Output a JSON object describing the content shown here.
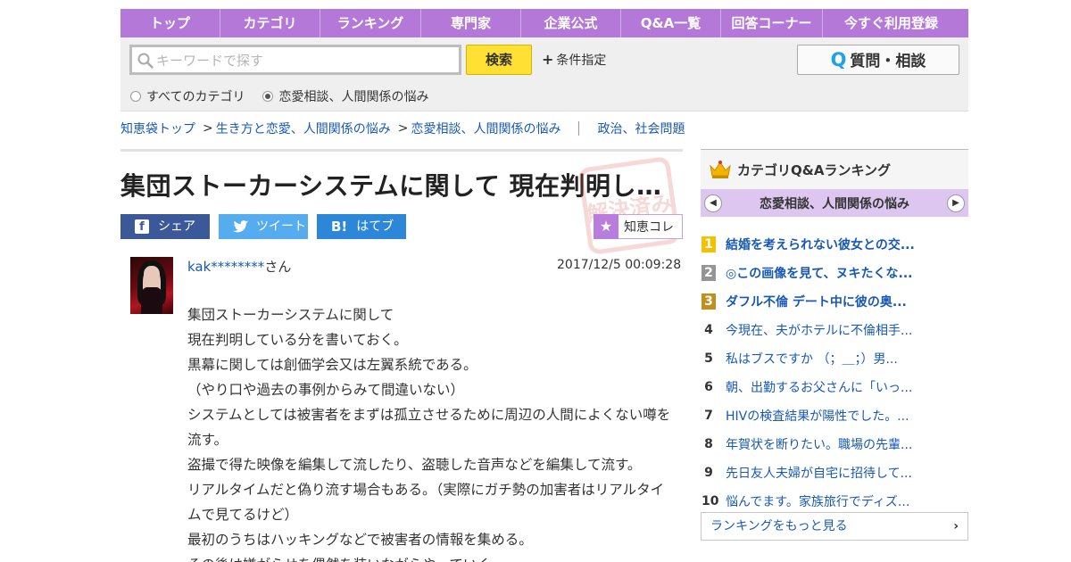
{
  "nav": {
    "items": [
      "トップ",
      "カテゴリ",
      "ランキング",
      "専門家",
      "企業公式",
      "Q&A一覧",
      "回答コーナー",
      "今すぐ利用登録"
    ]
  },
  "search": {
    "placeholder": "キーワードで探す",
    "button_label": "検索",
    "condition_label": "条件指定",
    "ask_label": "質問・相談",
    "ask_prefix": "Q",
    "radio_all": "すべてのカテゴリ",
    "radio_current": "恋愛相談、人間関係の悩み",
    "selected": "恋愛相談、人間関係の悩み"
  },
  "breadcrumb": {
    "items": [
      "知恵袋トップ",
      "生き方と恋愛、人間関係の悩み",
      "恋愛相談、人間関係の悩み"
    ],
    "sep": ">",
    "related": "政治、社会問題"
  },
  "question": {
    "title": "集団ストーカーシステムに関して 現在判明し…",
    "share_fb": "シェア",
    "share_tw": "ツイート",
    "share_hb": "はてブ",
    "share_hb_icon": "B!",
    "chiecolle": "知恵コレ",
    "stamp_text": "解決済み",
    "user": "kak********",
    "user_suffix": "さん",
    "date": "2017/12/5  00:09:28",
    "body": [
      "集団ストーカーシステムに関して",
      "現在判明している分を書いておく。",
      "黒幕に関しては創価学会又は左翼系統である。",
      "（やり口や過去の事例からみて間違いない）",
      "システムとしては被害者をまずは孤立させるために周辺の人間によくない噂を流す。",
      "盗撮で得た映像を編集して流したり、盗聴した音声などを編集して流す。",
      "リアルタイムだと偽り流す場合もある。（実際にガチ勢の加害者はリアルタイムで見てるけど）",
      "最初のうちはハッキングなどで被害者の情報を集める。",
      "その後は嫌がらせを偶然を装いながらやっていく。"
    ]
  },
  "ranking": {
    "header": "カテゴリQ&Aランキング",
    "category": "恋愛相談、人間関係の悩み",
    "items": [
      {
        "rank": "1",
        "title": "結婚を考えられない彼女との交..."
      },
      {
        "rank": "2",
        "title": "◎この画像を見て、ヌキたくな..."
      },
      {
        "rank": "3",
        "title": "ダフル不倫 デート中に彼の奥..."
      },
      {
        "rank": "4",
        "title": "今現在、夫がホテルに不倫相手..."
      },
      {
        "rank": "5",
        "title": "私はブスですか （；＿；）男..."
      },
      {
        "rank": "6",
        "title": "朝、出勤するお父さんに「いっ..."
      },
      {
        "rank": "7",
        "title": "HIVの検査結果が陽性でした。..."
      },
      {
        "rank": "8",
        "title": "年賀状を断りたい。職場の先輩..."
      },
      {
        "rank": "9",
        "title": "先日友人夫婦が自宅に招待して..."
      },
      {
        "rank": "10",
        "title": "悩んでます。家族旅行でディズ..."
      }
    ],
    "more_label": "ランキングをもっと見る"
  },
  "colors": {
    "nav_bg": "#b479d8",
    "link": "#1859b5",
    "search_btn": "#ffe033",
    "facebook": "#3b5998",
    "twitter": "#55acee",
    "hatena": "#2c87d8"
  }
}
